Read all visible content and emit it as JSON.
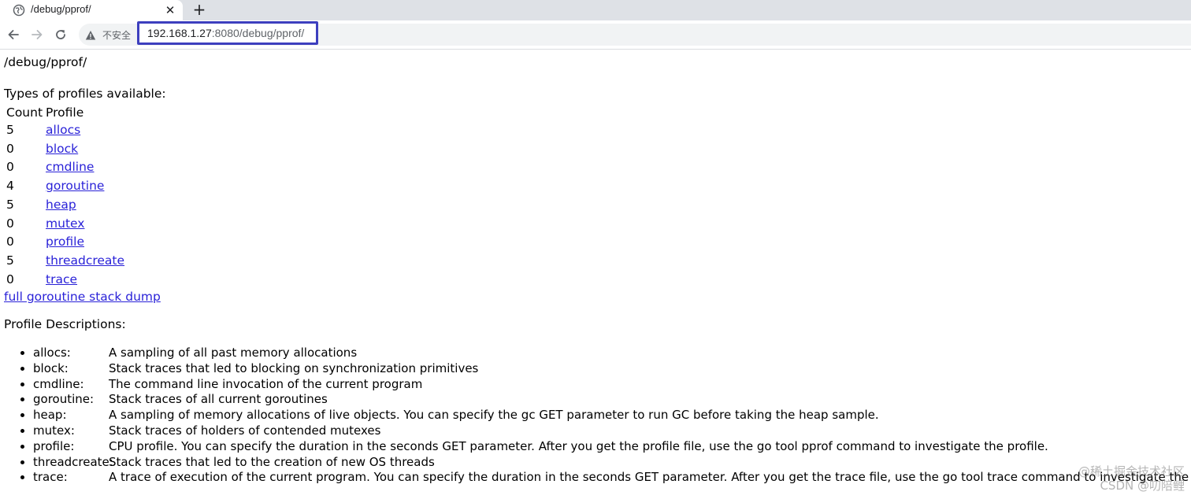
{
  "browser": {
    "tab_title": "/debug/pprof/",
    "tab_close_icon": "close-icon",
    "new_tab_icon": "plus-icon",
    "security_text": "不安全",
    "url_host": "192.168.1.27",
    "url_rest": ":8080/debug/pprof/",
    "highlight_color": "#3d3fbe"
  },
  "page": {
    "heading": "/debug/pprof/",
    "types_label": "Types of profiles available:",
    "table_headers": {
      "count": "Count",
      "profile": "Profile"
    },
    "profiles": [
      {
        "count": "5",
        "name": "allocs"
      },
      {
        "count": "0",
        "name": "block"
      },
      {
        "count": "0",
        "name": "cmdline"
      },
      {
        "count": "4",
        "name": "goroutine"
      },
      {
        "count": "5",
        "name": "heap"
      },
      {
        "count": "0",
        "name": "mutex"
      },
      {
        "count": "0",
        "name": "profile"
      },
      {
        "count": "5",
        "name": "threadcreate"
      },
      {
        "count": "0",
        "name": "trace"
      }
    ],
    "full_dump_link": "full goroutine stack dump",
    "descriptions_title": "Profile Descriptions:",
    "descriptions": [
      {
        "name": "allocs:",
        "text": "A sampling of all past memory allocations"
      },
      {
        "name": "block:",
        "text": "Stack traces that led to blocking on synchronization primitives"
      },
      {
        "name": "cmdline:",
        "text": "The command line invocation of the current program"
      },
      {
        "name": "goroutine:",
        "text": "Stack traces of all current goroutines"
      },
      {
        "name": "heap:",
        "text": "A sampling of memory allocations of live objects. You can specify the gc GET parameter to run GC before taking the heap sample."
      },
      {
        "name": "mutex:",
        "text": "Stack traces of holders of contended mutexes"
      },
      {
        "name": "profile:",
        "text": "CPU profile. You can specify the duration in the seconds GET parameter. After you get the profile file, use the go tool pprof command to investigate the profile."
      },
      {
        "name": "threadcreate:",
        "text": "Stack traces that led to the creation of new OS threads"
      },
      {
        "name": "trace:",
        "text": "A trace of execution of the current program. You can specify the duration in the seconds GET parameter. After you get the trace file, use the go tool trace command to investigate the trace."
      }
    ],
    "link_color": "#2a22d8"
  },
  "watermark": {
    "line1": "@稀土掘金技术社区",
    "line2": "CSDN @叨陪鲤"
  }
}
